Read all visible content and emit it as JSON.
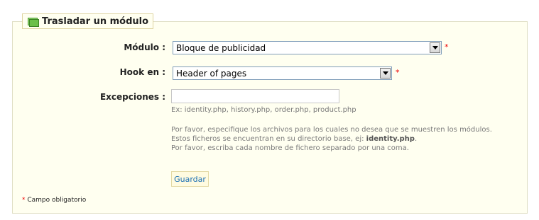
{
  "legend": {
    "title": "Trasladar un módulo",
    "icon": "module-icon"
  },
  "form": {
    "module": {
      "label": "Módulo :",
      "value": "Bloque de publicidad",
      "required_mark": "*"
    },
    "hook": {
      "label": "Hook en :",
      "value": "Header of pages",
      "required_mark": "*"
    },
    "exceptions": {
      "label": "Excepciones :",
      "value": "",
      "example": "Ex: identity.php, history.php, order.php, product.php",
      "help_line1": "Por favor, especifique los archivos para los cuales no desea que se muestren los módulos.",
      "help_line2_prefix": "Estos ficheros se encuentran en su directorio base, ej: ",
      "help_line2_bold": "identity.php",
      "help_line2_suffix": ".",
      "help_line3": "Por favor, escriba cada nombre de fichero separado por una coma."
    },
    "save_label": "Guardar"
  },
  "footnote": {
    "star": "*",
    "text": " Campo obligatorio"
  },
  "colors": {
    "panel_bg": "#fffff0",
    "panel_border": "#e0dfc5",
    "required": "#ee0000",
    "button_text": "#1a6fb3"
  }
}
